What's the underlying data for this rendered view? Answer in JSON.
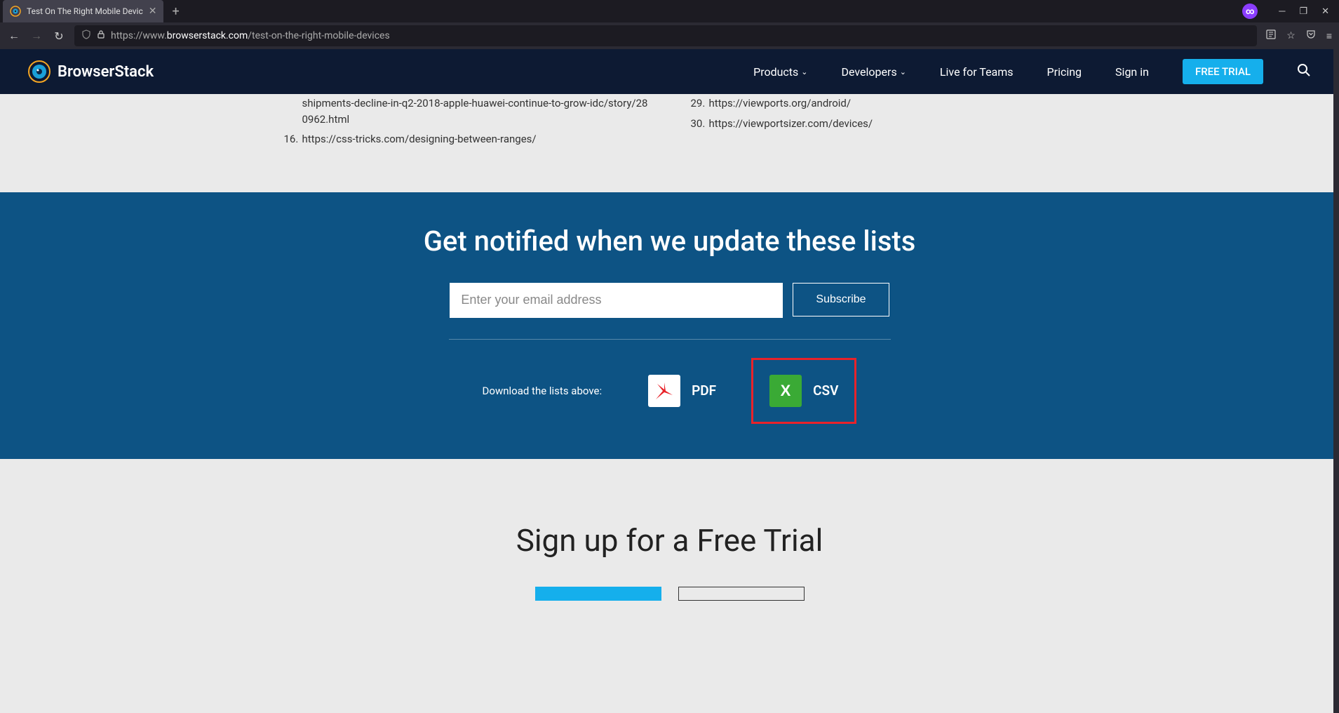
{
  "browser": {
    "tab_title": "Test On The Right Mobile Devic",
    "url_prefix": "https://www.",
    "url_domain": "browserstack.com",
    "url_path": "/test-on-the-right-mobile-devices"
  },
  "header": {
    "logo_text": "BrowserStack",
    "nav": {
      "products": "Products",
      "developers": "Developers",
      "live_for_teams": "Live for Teams",
      "pricing": "Pricing",
      "sign_in": "Sign in",
      "free_trial": "FREE TRIAL"
    }
  },
  "references": {
    "left": [
      {
        "num": "",
        "text": "shipments-decline-in-q2-2018-apple-huawei-continue-to-grow-idc/story/280962.html"
      },
      {
        "num": "16.",
        "text": "https://css-tricks.com/designing-between-ranges/"
      }
    ],
    "right": [
      {
        "num": "29.",
        "text": "https://viewports.org/android/"
      },
      {
        "num": "30.",
        "text": "https://viewportsizer.com/devices/"
      }
    ]
  },
  "notify": {
    "title": "Get notified when we update these lists",
    "email_placeholder": "Enter your email address",
    "subscribe_label": "Subscribe",
    "download_label": "Download the lists above:",
    "pdf_label": "PDF",
    "csv_label": "CSV"
  },
  "signup": {
    "title": "Sign up for a Free Trial"
  }
}
